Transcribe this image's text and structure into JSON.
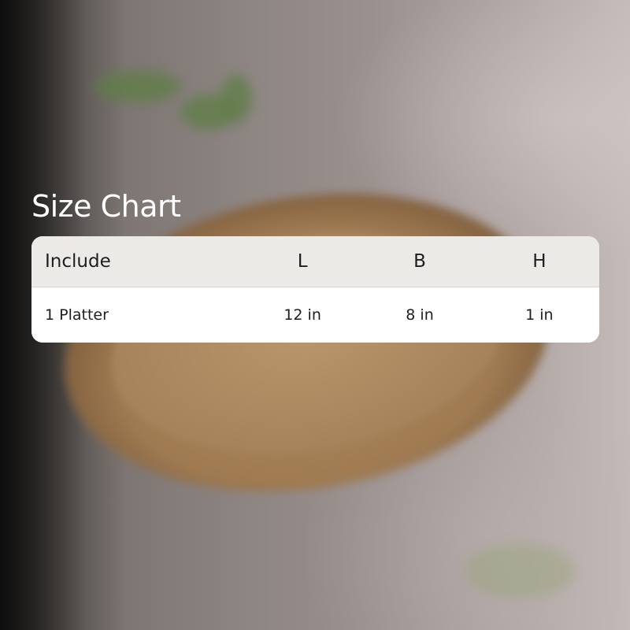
{
  "title": "Size Chart",
  "table": {
    "headers": [
      "Include",
      "L",
      "B",
      "H"
    ],
    "rows": [
      [
        "1 Platter",
        "12 in",
        "8 in",
        "1 in"
      ]
    ]
  },
  "colors": {
    "header_bg": "#eceae6",
    "body_bg": "#ffffff",
    "title_text": "#ffffff",
    "cell_text": "#1e1e1e"
  }
}
